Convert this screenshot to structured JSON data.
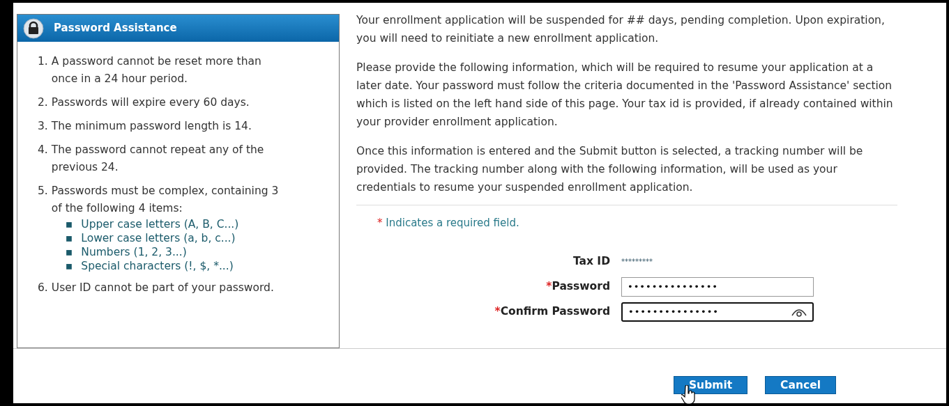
{
  "assistance_panel": {
    "title": "Password Assistance",
    "rules": [
      {
        "number": "1.",
        "text": "A password cannot be reset more than once in a 24 hour period."
      },
      {
        "number": "2.",
        "text": "Passwords will expire every 60 days."
      },
      {
        "number": "3.",
        "text": "The minimum password length is 14."
      },
      {
        "number": "4.",
        "text": "The password cannot repeat any of the previous 24."
      },
      {
        "number": "5.",
        "text": "Passwords must be complex, containing 3 of the following 4 items:",
        "children": [
          {
            "bullet": "▪",
            "text": "Upper case letters (A, B, C...)"
          },
          {
            "bullet": "▪",
            "text": "Lower case letters (a, b, c...)"
          },
          {
            "bullet": "▪",
            "text": "Numbers (1, 2, 3...)"
          },
          {
            "bullet": "▪",
            "text": "Special characters (!, $, *...)"
          }
        ]
      },
      {
        "number": "6.",
        "text": "User ID cannot be part of your password."
      }
    ]
  },
  "paragraphs": [
    "Your enrollment application will be suspended for ## days, pending completion. Upon expiration, you will need to reinitiate a new enrollment application.",
    "Please provide the following information, which will be required to resume your application at a later date. Your password must follow the criteria documented in the 'Password Assistance' section which is listed on the left hand side of this page. Your tax id is provided, if already contained within your provider enrollment application.",
    "Once this information is entered and the Submit button is selected, a tracking number will be provided. The tracking number along with the following information, will be used as your credentials to resume your suspended enrollment application."
  ],
  "required_note": {
    "mark": "*",
    "text": "Indicates a required field."
  },
  "form": [
    {
      "kind": "static",
      "label": "Tax ID",
      "required": false,
      "value": "*********"
    },
    {
      "kind": "input",
      "label": "Password",
      "required": true,
      "value": "•••••••••••••••",
      "focused": false,
      "reveal_icon": false
    },
    {
      "kind": "input",
      "label": "Confirm Password",
      "required": true,
      "value": "•••••••••••••••",
      "focused": true,
      "reveal_icon": true
    }
  ],
  "required_mark": "*",
  "buttons": [
    "Submit",
    "Cancel"
  ]
}
